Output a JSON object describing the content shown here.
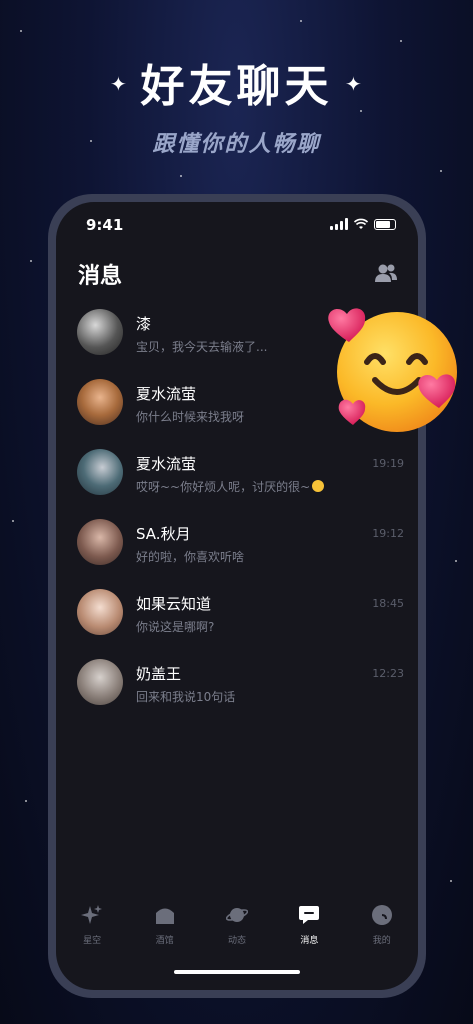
{
  "headline": {
    "title": "好友聊天",
    "subtitle": "跟懂你的人畅聊"
  },
  "status_bar": {
    "time": "9:41"
  },
  "page": {
    "title": "消息"
  },
  "conversations": [
    {
      "name": "漆",
      "preview": "宝贝，我今天去输液了...",
      "time": ""
    },
    {
      "name": "夏水流萤",
      "preview": "你什么时候来找我呀",
      "time": ""
    },
    {
      "name": "夏水流萤",
      "preview": "哎呀~~你好烦人呢，讨厌的很~",
      "time": "19:19"
    },
    {
      "name": "SA.秋月",
      "preview": "好的啦，你喜欢听啥",
      "time": "19:12"
    },
    {
      "name": "如果云知道",
      "preview": "你说这是哪啊?",
      "time": "18:45"
    },
    {
      "name": "奶盖王",
      "preview": "回来和我说10句话",
      "time": "12:23"
    }
  ],
  "tabs": [
    {
      "label": "星空",
      "icon": "sparkle-icon",
      "active": false
    },
    {
      "label": "酒馆",
      "icon": "tavern-icon",
      "active": false
    },
    {
      "label": "动态",
      "icon": "planet-icon",
      "active": false
    },
    {
      "label": "消息",
      "icon": "message-icon",
      "active": true
    },
    {
      "label": "我的",
      "icon": "profile-icon",
      "active": false
    }
  ],
  "colors": {
    "background": "#0e1433",
    "screen": "#16161d",
    "frame": "#3a3f55",
    "preview_text": "#7b7e8c",
    "tab_inactive": "#6b6e7b"
  }
}
